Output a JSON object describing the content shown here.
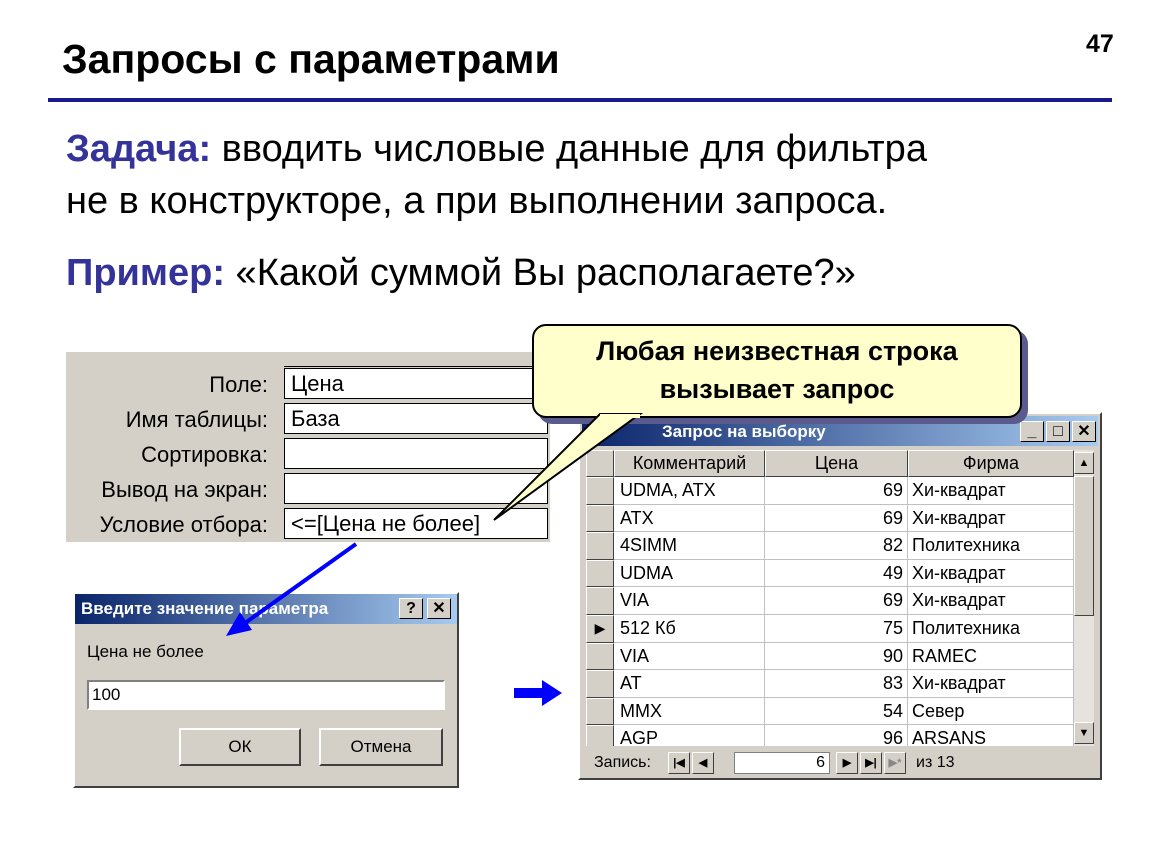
{
  "slide": {
    "title": "Запросы с параметрами",
    "number": "47",
    "task_label": "Задача:",
    "task_text_line1": " вводить числовые данные для фильтра",
    "task_text_line2": "не в конструкторе, а при выполнении запроса.",
    "example_label": "Пример:",
    "example_text": " «Какой суммой Вы располагаете?»"
  },
  "callout": {
    "line1": "Любая неизвестная строка",
    "line2": "вызывает запрос"
  },
  "designer": {
    "rows": [
      {
        "label": "Поле:",
        "value": "Цена"
      },
      {
        "label": "Имя таблицы:",
        "value": "База"
      },
      {
        "label": "Сортировка:",
        "value": ""
      },
      {
        "label": "Вывод на экран:",
        "value": "",
        "checked": true
      },
      {
        "label": "Условие отбора:",
        "value": "<=[Цена не более]"
      }
    ],
    "check_glyph": "✔"
  },
  "dialog": {
    "title": "Введите значение параметра",
    "help_button": "?",
    "close_button": "✕",
    "prompt": "Цена не более",
    "input_value": "100",
    "ok_label": "ОК",
    "cancel_label": "Отмена"
  },
  "results": {
    "title": "Запрос на выборку",
    "min_button": "_",
    "max_button": "□",
    "close_button": "✕",
    "columns": [
      "Комментарий",
      "Цена",
      "Фирма"
    ],
    "rows": [
      [
        "UDMA, ATX",
        "69",
        "Хи-квадрат"
      ],
      [
        "ATX",
        "69",
        "Хи-квадрат"
      ],
      [
        "4SIMM",
        "82",
        "Политехника"
      ],
      [
        "UDMA",
        "49",
        "Хи-квадрат"
      ],
      [
        "VIA",
        "69",
        "Хи-квадрат"
      ],
      [
        "512 Кб",
        "75",
        "Политехника"
      ],
      [
        "VIA",
        "90",
        "RAMEC"
      ],
      [
        "AT",
        "83",
        "Хи-квадрат"
      ],
      [
        "MMX",
        "54",
        "Север"
      ],
      [
        "AGP",
        "96",
        "ARSANS"
      ]
    ],
    "current_row_marker": "▶",
    "nav": {
      "label": "Запись:",
      "current": "6",
      "total": "из 13"
    }
  },
  "colors": {
    "heading_accent": "#333399",
    "arrow": "#0000ff",
    "callout_fill": "#ffffcc",
    "title_bar": "#0a246a"
  }
}
